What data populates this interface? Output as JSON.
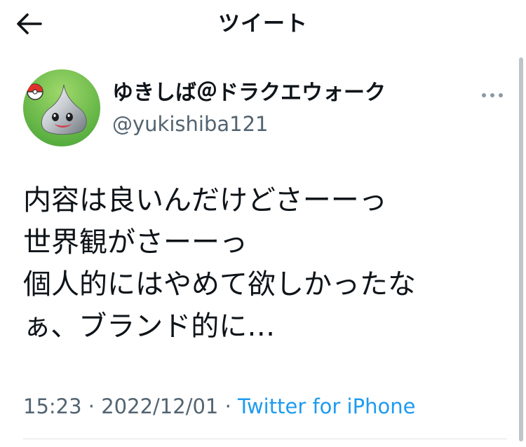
{
  "header": {
    "back_icon": "back-arrow-icon",
    "title": "ツイート"
  },
  "author": {
    "display_name": "ゆきしば＠ドラクエウォーク",
    "handle": "@yukishiba121",
    "avatar_icon": "metal-slime-avatar"
  },
  "more_icon": "more-options-icon",
  "tweet": {
    "lines": [
      "内容は良いんだけどさーーっ",
      "世界観がさーーっ",
      "個人的にはやめて欲しかったな",
      "ぁ、ブランド的に…"
    ]
  },
  "meta": {
    "time": "15:23",
    "separator": " · ",
    "date": "2022/12/01",
    "source": "Twitter for iPhone"
  },
  "colors": {
    "text": "#0f1419",
    "secondary": "#536471",
    "link": "#1d9bf0"
  }
}
